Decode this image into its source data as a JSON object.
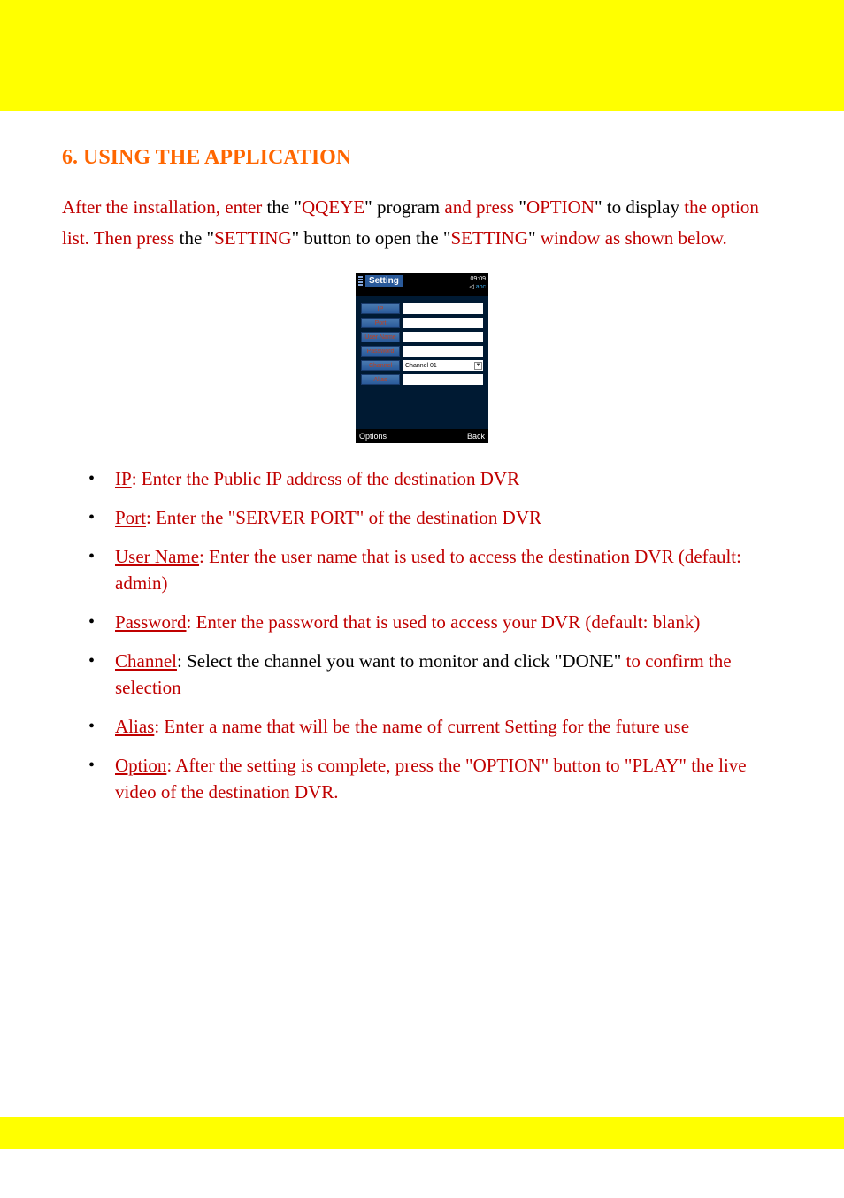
{
  "header": {
    "section_title": "6. USING THE APPLICATION"
  },
  "intro": {
    "runs": [
      {
        "cls": "red",
        "text": "After the installation, enter "
      },
      {
        "cls": "black",
        "text": "the \""
      },
      {
        "cls": "red",
        "text": "QQEYE"
      },
      {
        "cls": "black",
        "text": "\" program"
      },
      {
        "cls": "red",
        "text": " and press "
      },
      {
        "cls": "black",
        "text": "\""
      },
      {
        "cls": "red",
        "text": "OPTION"
      },
      {
        "cls": "black",
        "text": "\" to display "
      },
      {
        "cls": "red",
        "text": "the option list. Then press "
      },
      {
        "cls": "black",
        "text": "the \""
      },
      {
        "cls": "red",
        "text": "SETTING"
      },
      {
        "cls": "black",
        "text": "\" button to open the \""
      },
      {
        "cls": "red",
        "text": "SETTING"
      },
      {
        "cls": "black",
        "text": "\" "
      },
      {
        "cls": "red",
        "text": "window as shown below."
      }
    ]
  },
  "phone": {
    "title": "Setting",
    "time": "09:09",
    "mode": "abc",
    "labels": {
      "ip": "IP",
      "port": "Port",
      "username": "User Name",
      "password": "Password",
      "channel": "Channel",
      "alias": "Alias"
    },
    "channel_value": "Channel 01",
    "options": "Options",
    "back": "Back"
  },
  "bullets": [
    {
      "term": "IP",
      "desc": ": Enter the Public IP address of the destination DVR"
    },
    {
      "term": "Port",
      "desc": ": Enter the \"SERVER PORT\" of the destination DVR"
    },
    {
      "term": "User Name",
      "desc": ": Enter the user name that is used to access the destination DVR (default: admin)"
    },
    {
      "term": "Password",
      "desc": ": Enter the password that is used to access your DVR (default: blank)"
    },
    {
      "term": "Channel",
      "black_desc": ": Select the channel you want to monitor and click \"DONE\" ",
      "desc": "to confirm the selection"
    },
    {
      "term": "Alias",
      "desc": ": Enter a name that will be the name of current Setting for the future use"
    },
    {
      "term": "Option",
      "desc": ": After the setting is complete, press the \"OPTION\" button to \"PLAY\" the live video of the destination DVR."
    }
  ]
}
